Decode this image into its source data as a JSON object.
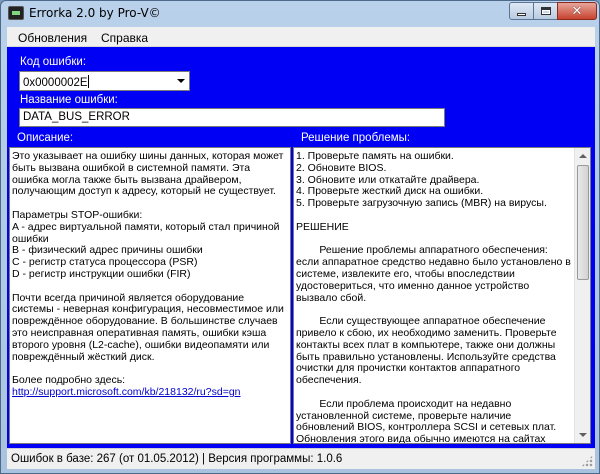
{
  "window": {
    "title": "Errorka 2.0 by Pro-V©"
  },
  "menu": {
    "updates": "Обновления",
    "help": "Справка"
  },
  "form": {
    "code_label": "Код ошибки:",
    "code_value": "0x0000002E",
    "name_label": "Название ошибки:",
    "name_value": "DATA_BUS_ERROR",
    "description_label": "Описание:",
    "solution_label": "Решение проблемы:"
  },
  "description": {
    "text": "Это указывает на ошибку шины данных, которая может быть вызвана ошибкой в системной памяти. Эта ошибка могла также быть вызвана драйвером, получающим доступ к адресу, который не существует.\n\nПараметры STOP-ошибки:\nA - адрес виртуальной памяти, который стал причиной ошибки\nB - физический адрес причины ошибки\nC - регистр статуса процессора (PSR)\nD - регистр инструкции ошибки (FIR)\n\nПочти всегда причиной является оборудование системы - неверная конфигурация, несовместимое или повреждённое оборудование. В большинстве случаев это неисправная оперативная память, ошибки кэша второго уровня (L2-cache), ошибки видеопамяти или повреждённый жёсткий диск.\n\nБолее подробно здесь:\n",
    "link": "http://support.microsoft.com/kb/218132/ru?sd=gn"
  },
  "solution": {
    "text": "1. Проверьте память на ошибки.\n2. Обновите BIOS.\n3. Обновите или откатайте драйвера.\n4. Проверьте жесткий диск на ошибки.\n5. Проверьте загрузочную запись (MBR) на вирусы.\n\nРЕШЕНИЕ\n\n        Решение проблемы аппаратного обеспечения: если аппаратное средство недавно было установлено в системе, извлеките его, чтобы впоследствии удостовериться, что именно данное устройство вызвало сбой.\n\n        Если существующее аппаратное обеспечение привело к сбою, их необходимо заменить. Проверьте контакты всех плат в компьютере, также они должны быть правильно установлены. Используйте средства очистки для прочистки контактов аппаратного обеспечения.\n\n        Если проблема происходит на недавно установленной системе, проверьте наличие обновлений BIOS, контроллера SCSI и сетевых плат. Обновления этого вида обычно имеются на сайтах производителя оборудования.\n\n        Если ошибка происходит после установки нового или"
  },
  "status": {
    "text": "Ошибок в базе: 267 (от 01.05.2012) | Версия программы: 1.0.6"
  },
  "icons": {
    "app": "terminal-icon",
    "minimize": "minimize-icon",
    "maximize": "maximize-icon",
    "close": "close-icon",
    "dropdown": "chevron-down-icon"
  },
  "colors": {
    "client_background": "#0000f5",
    "label_text": "#ffffff",
    "link": "#0000cc"
  }
}
